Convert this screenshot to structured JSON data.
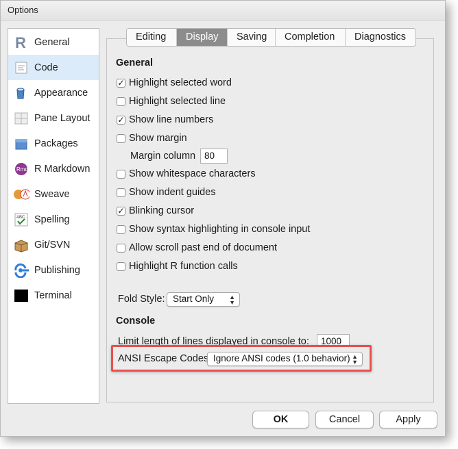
{
  "window": {
    "title": "Options"
  },
  "sidebar": {
    "items": [
      {
        "label": "General",
        "icon": "r-logo-icon",
        "selected": false
      },
      {
        "label": "Code",
        "icon": "code-icon",
        "selected": true
      },
      {
        "label": "Appearance",
        "icon": "paint-bucket-icon",
        "selected": false
      },
      {
        "label": "Pane Layout",
        "icon": "pane-layout-icon",
        "selected": false
      },
      {
        "label": "Packages",
        "icon": "package-icon",
        "selected": false
      },
      {
        "label": "R Markdown",
        "icon": "rmd-icon",
        "selected": false
      },
      {
        "label": "Sweave",
        "icon": "sweave-icon",
        "selected": false
      },
      {
        "label": "Spelling",
        "icon": "spelling-icon",
        "selected": false
      },
      {
        "label": "Git/SVN",
        "icon": "git-box-icon",
        "selected": false
      },
      {
        "label": "Publishing",
        "icon": "publishing-icon",
        "selected": false
      },
      {
        "label": "Terminal",
        "icon": "terminal-icon",
        "selected": false
      }
    ]
  },
  "tabs": [
    {
      "label": "Editing",
      "active": false
    },
    {
      "label": "Display",
      "active": true
    },
    {
      "label": "Saving",
      "active": false
    },
    {
      "label": "Completion",
      "active": false
    },
    {
      "label": "Diagnostics",
      "active": false
    }
  ],
  "general": {
    "heading": "General",
    "options": [
      {
        "label": "Highlight selected word",
        "checked": true
      },
      {
        "label": "Highlight selected line",
        "checked": false
      },
      {
        "label": "Show line numbers",
        "checked": true
      },
      {
        "label": "Show margin",
        "checked": false
      },
      {
        "label": "Show whitespace characters",
        "checked": false
      },
      {
        "label": "Show indent guides",
        "checked": false
      },
      {
        "label": "Blinking cursor",
        "checked": true
      },
      {
        "label": "Show syntax highlighting in console input",
        "checked": false
      },
      {
        "label": "Allow scroll past end of document",
        "checked": false
      },
      {
        "label": "Highlight R function calls",
        "checked": false
      }
    ],
    "margin_column_label": "Margin column",
    "margin_column_value": "80",
    "fold_style_label": "Fold Style:",
    "fold_style_value": "Start Only"
  },
  "console": {
    "heading": "Console",
    "limit_label": "Limit length of lines displayed in console to:",
    "limit_value": "1000",
    "ansi_label": "ANSI Escape Codes:",
    "ansi_value": "Ignore ANSI codes (1.0 behavior)"
  },
  "buttons": {
    "ok": "OK",
    "cancel": "Cancel",
    "apply": "Apply"
  },
  "colors": {
    "highlight_border": "#e8504d",
    "selected_row": "#dcebf9",
    "active_tab": "#8c8c8c"
  }
}
